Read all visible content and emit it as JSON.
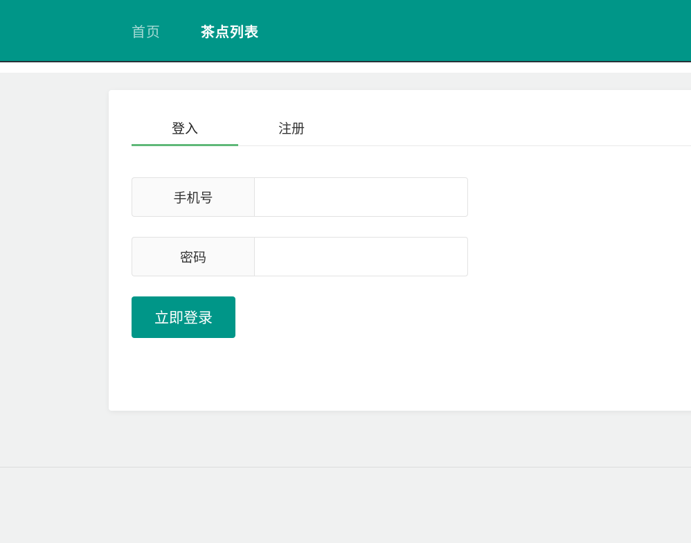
{
  "colors": {
    "header_bg": "#009688",
    "header_border": "#263238",
    "tab_active_underline": "#5fb878",
    "button_bg": "#009688",
    "page_bg": "#f0f1f1"
  },
  "header": {
    "nav": [
      {
        "label": "首页",
        "active": false
      },
      {
        "label": "茶点列表",
        "active": true
      }
    ]
  },
  "auth_card": {
    "tabs": [
      {
        "label": "登入",
        "active": true
      },
      {
        "label": "注册",
        "active": false
      }
    ],
    "fields": [
      {
        "label": "手机号",
        "value": "",
        "placeholder": ""
      },
      {
        "label": "密码",
        "value": "",
        "placeholder": ""
      }
    ],
    "submit_label": "立即登录"
  }
}
